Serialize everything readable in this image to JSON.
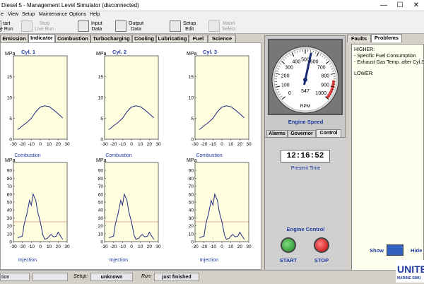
{
  "window": {
    "title": "Diesel 5 - Management Level Simulator (disconnected)",
    "minimize": "—",
    "maximize": "☐",
    "close": "✕"
  },
  "menu": [
    "e",
    "View",
    "Setup",
    "Maintenance",
    "Options",
    "Help"
  ],
  "toolbar": {
    "start": "tart\ne Run",
    "stop": "Stop\nLive Run",
    "input": "Input\nData",
    "output": "Output\nData",
    "setup": "Setup\nEdit",
    "maint": "Maint\nSelect"
  },
  "tabs": [
    "Emission",
    "Indicator",
    "Combustion",
    "Turbocharging",
    "Cooling",
    "Lubricating",
    "Fuel",
    "Science"
  ],
  "active_tab": "Indicator",
  "cylinders": [
    "Cyl. 1",
    "Cyl. 2",
    "Cyl. 3"
  ],
  "combustion_label": "Combustion",
  "injection_label": "Injection",
  "unit": "MPa",
  "combustion_axis": {
    "ylim": [
      0,
      20
    ],
    "yticks": [
      "20",
      "15",
      "10",
      "5",
      "0"
    ],
    "xlim": [
      -30,
      30
    ],
    "xticks": [
      "-30",
      "-20",
      "-10",
      "0",
      "10",
      "20",
      "30"
    ]
  },
  "injection_axis": {
    "ylim": [
      0,
      100
    ],
    "yticks": [
      "100",
      "90",
      "80",
      "70",
      "60",
      "50",
      "40",
      "30",
      "20",
      "10",
      "0"
    ],
    "xlim": [
      -30,
      30
    ],
    "xticks": [
      "-30",
      "-20",
      "-10",
      "0",
      "10",
      "20",
      "30"
    ]
  },
  "chart_data": [
    {
      "type": "line",
      "title": "Combustion",
      "ylabel": "MPa",
      "xlim": [
        -30,
        30
      ],
      "ylim": [
        0,
        20
      ],
      "series": [
        {
          "x": [
            -25,
            -20,
            -15,
            -10,
            -5,
            0,
            5,
            10,
            15,
            20,
            25
          ],
          "values": [
            2.3,
            3.2,
            4.0,
            5.0,
            6.6,
            7.7,
            8.0,
            7.8,
            7.0,
            6.1,
            5.1
          ]
        }
      ]
    },
    {
      "type": "line",
      "title": "Injection",
      "ylabel": "MPa",
      "xlim": [
        -30,
        30
      ],
      "ylim": [
        0,
        100
      ],
      "series": [
        {
          "x": [
            -25,
            -20,
            -18,
            -15,
            -12,
            -10,
            -8,
            -5,
            -3,
            0,
            3,
            5,
            8,
            10,
            12,
            15,
            18,
            20,
            22,
            25
          ],
          "values": [
            5,
            7,
            22,
            35,
            52,
            46,
            60,
            52,
            38,
            25,
            8,
            3,
            4,
            7,
            9,
            6,
            7,
            12,
            8,
            3
          ]
        }
      ]
    }
  ],
  "gauge": {
    "value": 547,
    "max": 1000,
    "ticks": [
      "0",
      "100",
      "200",
      "300",
      "400",
      "500",
      "600",
      "700",
      "800",
      "900",
      "1000"
    ],
    "unit": "RPM",
    "readout": "547"
  },
  "engine_speed_label": "Engine Speed",
  "control_tabs": [
    "Alarms",
    "Governor",
    "Control"
  ],
  "active_control_tab": "Control",
  "clock": "12:16:52",
  "present_time_label": "Present Time",
  "engine_control_label": "Engine Control",
  "start_label": "START",
  "stop_label": "STOP",
  "right_tabs": [
    "Faults",
    "Problems"
  ],
  "problems": {
    "higher": "HIGHER:",
    "higher_items": [
      "- Specific Fuel Consumption",
      "- Exhaust Gas Temp. after Cyl.3"
    ],
    "lower": "LOWER:"
  },
  "show_label": "Show",
  "hide_label": "Hide",
  "status": {
    "left": "tion",
    "setup_label": "Setup:",
    "setup_value": "unknown",
    "run_label": "Run:",
    "run_value": "just finished"
  },
  "logo": {
    "line1": "UNITE",
    "line2": "MARINE SIMU"
  },
  "colors": {
    "plot_bg": "#ffffe0",
    "trace": "#1f2a80",
    "red_line": "#e05050",
    "blue_label": "#1f3aa0"
  }
}
